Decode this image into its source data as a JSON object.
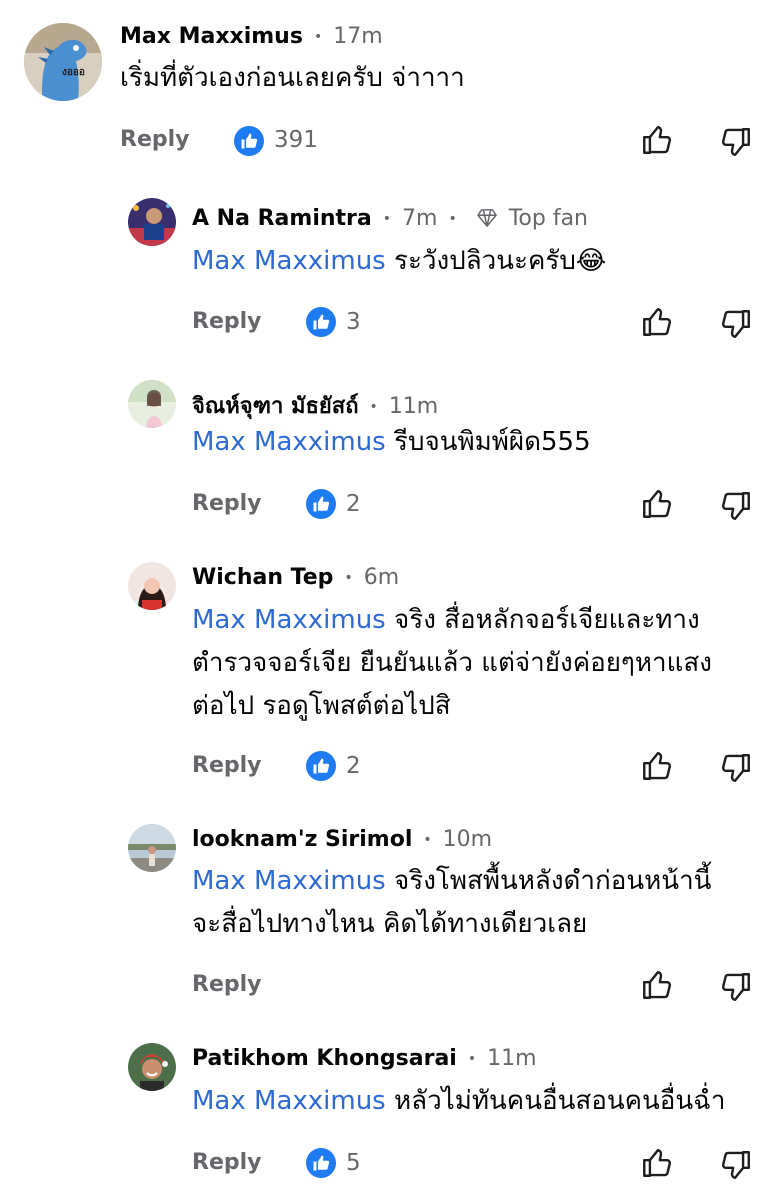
{
  "comments": [
    {
      "name": "Max Maxximus",
      "time": "17m",
      "badge": "",
      "mention": "",
      "lines": [
        "เริ่มที่ตัวเองก่อนเลยครับ จ่าาาา"
      ],
      "reply_label": "Reply",
      "likes": "391"
    },
    {
      "name": "A Na Ramintra",
      "time": "7m",
      "badge": "Top fan",
      "mention": "Max Maxximus",
      "lines": [
        " ระวังปลิวนะครับ😂"
      ],
      "reply_label": "Reply",
      "likes": "3"
    },
    {
      "name": "จิณห์จุฑา มัธยัสถ์",
      "time": "11m",
      "badge": "",
      "mention": "Max Maxximus",
      "lines": [
        " รีบจนพิมพ์ผิด555"
      ],
      "reply_label": "Reply",
      "likes": "2"
    },
    {
      "name": "Wichan Tep",
      "time": "6m",
      "badge": "",
      "mention": "Max Maxximus",
      "lines": [
        " จริง สื่อหลักจอร์เจียและทาง",
        "ตำรวจจอร์เจีย ยืนยันแล้ว แต่จ่ายังค่อยๆหาแสง",
        "ต่อไป รอดูโพสต์ต่อไปสิ"
      ],
      "reply_label": "Reply",
      "likes": "2"
    },
    {
      "name": "looknam'z Sirimol",
      "time": "10m",
      "badge": "",
      "mention": "Max Maxximus",
      "lines": [
        " จริงโพสพื้นหลังดำก่อนหน้านี้",
        "จะสื่อไปทางไหน คิดได้ทางเดียวเลย"
      ],
      "reply_label": "Reply",
      "likes": ""
    },
    {
      "name": "Patikhom Khongsarai",
      "time": "11m",
      "badge": "",
      "mention": "Max Maxximus",
      "lines": [
        " หลัวไม่ทันคนอื่นสอนคนอื่นฉ่ำ"
      ],
      "reply_label": "Reply",
      "likes": "5"
    }
  ],
  "avatar_captions": {
    "max": "งอออ"
  },
  "icons": {
    "like_badge": "thumbs-up-badge-icon",
    "like_button": "thumbs-up-outline-icon",
    "dislike_button": "thumbs-down-outline-icon",
    "top_fan": "diamond-icon"
  },
  "colors": {
    "mention": "#2e6ad4",
    "like_badge": "#1f7bf2",
    "meta": "#65676b"
  }
}
